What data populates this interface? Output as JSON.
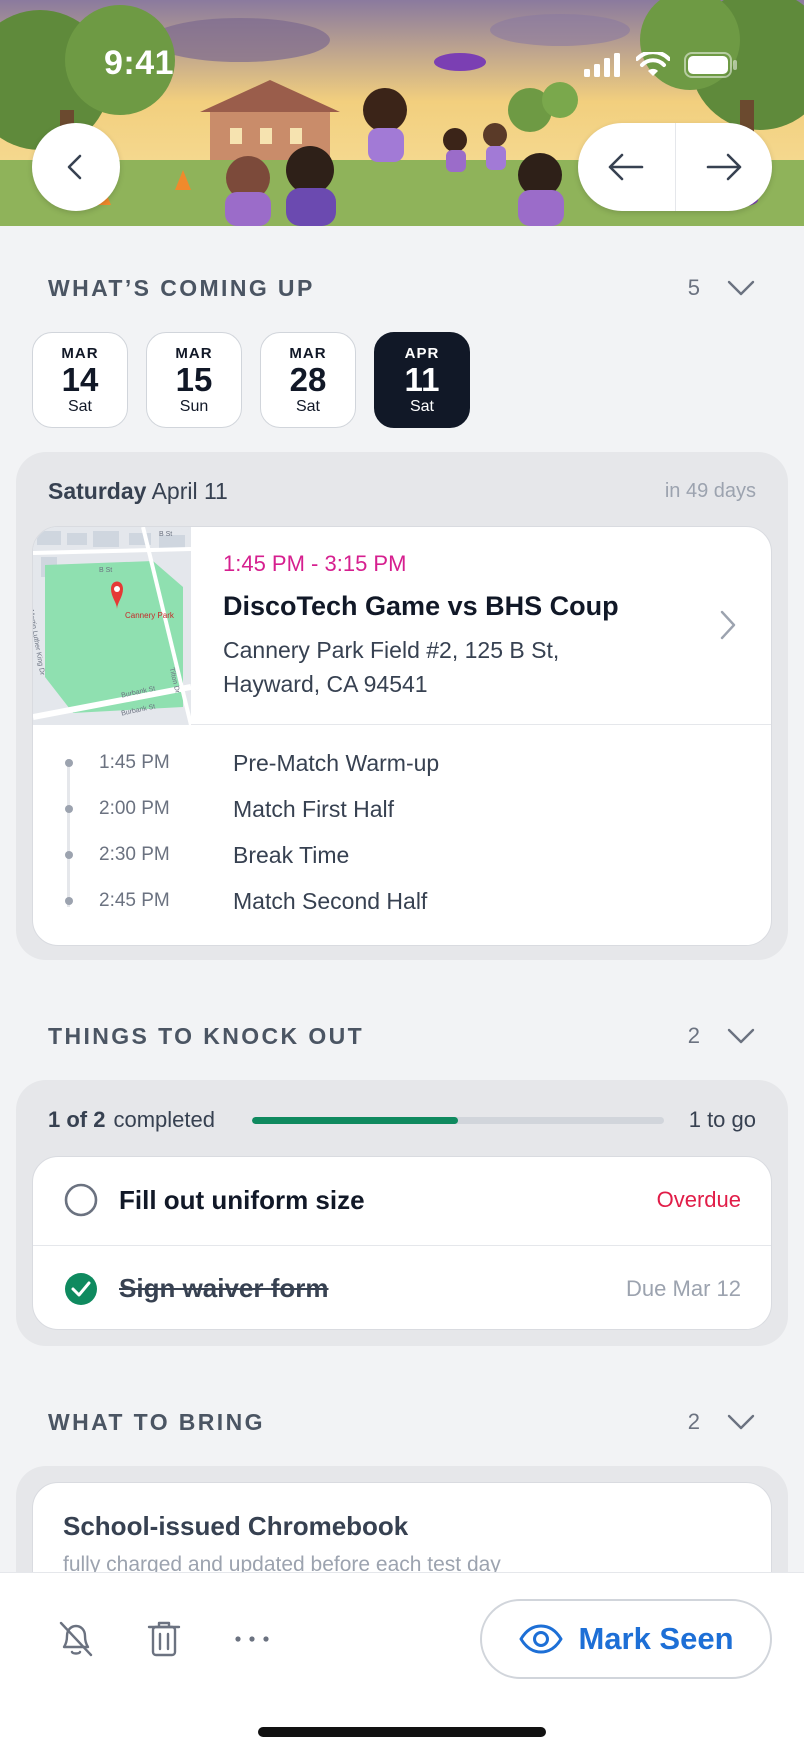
{
  "status": {
    "time": "9:41"
  },
  "coming_up": {
    "title": "WHAT’S COMING UP",
    "count": "5",
    "dates": [
      {
        "mon": "MAR",
        "day": "14",
        "wd": "Sat",
        "active": false
      },
      {
        "mon": "MAR",
        "day": "15",
        "wd": "Sun",
        "active": false
      },
      {
        "mon": "MAR",
        "day": "28",
        "wd": "Sat",
        "active": false
      },
      {
        "mon": "APR",
        "day": "11",
        "wd": "Sat",
        "active": true
      }
    ],
    "selected_weekday": "Saturday",
    "selected_date": "April 11",
    "relative": "in 49 days",
    "event": {
      "time_range": "1:45 PM - 3:15 PM",
      "title": "DiscoTech Game vs BHS Coup",
      "address_line1": "Cannery Park Field #2, 125 B St,",
      "address_line2": "Hayward, CA 94541",
      "map_label": "Cannery Park",
      "map_streets": [
        "B St",
        "B St",
        "Martin Luther King Dr",
        "Burbank St",
        "Burbank St",
        "Tilton Dr"
      ],
      "schedule": [
        {
          "time": "1:45 PM",
          "label": "Pre-Match Warm-up"
        },
        {
          "time": "2:00 PM",
          "label": "Match First Half"
        },
        {
          "time": "2:30 PM",
          "label": "Break Time"
        },
        {
          "time": "2:45 PM",
          "label": "Match Second Half"
        }
      ]
    }
  },
  "knock_out": {
    "title": "THINGS TO KNOCK OUT",
    "count": "2",
    "completed_count": "1 of 2",
    "completed_suffix": "completed",
    "remaining": "1 to go",
    "progress_fraction": 0.5,
    "tasks": [
      {
        "label": "Fill out uniform size",
        "meta": "Overdue",
        "done": false
      },
      {
        "label": "Sign waiver form",
        "meta": "Due Mar 12",
        "done": true
      }
    ]
  },
  "bring": {
    "title": "WHAT TO BRING",
    "count": "2",
    "items": [
      {
        "title": "School-issued Chromebook",
        "subtitle": "fully charged and updated before each test day"
      }
    ]
  },
  "bottom": {
    "mark_seen": "Mark Seen"
  },
  "colors": {
    "accent_blue": "#1d6fd6",
    "event_time": "#d61f8f",
    "overdue": "#e11d48",
    "progress": "#0f8a5f",
    "dark_chip": "#111827"
  }
}
